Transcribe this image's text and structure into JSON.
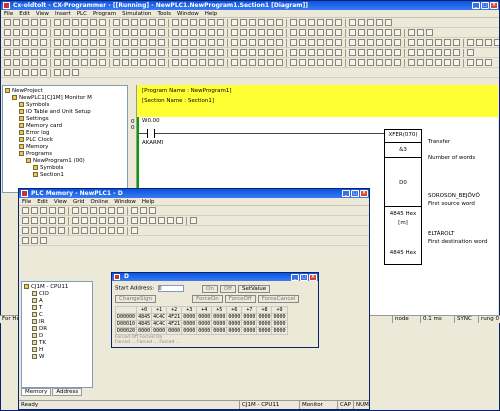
{
  "main": {
    "title": "Cx-oldtolt - CX-Programmer - [[Running] - NewPLC1.NewProgram1.Section1 [Diagram]]",
    "menu": [
      "File",
      "Edit",
      "View",
      "Insert",
      "PLC",
      "Program",
      "Simulation",
      "Tools",
      "Window",
      "Help"
    ]
  },
  "project": {
    "items": [
      {
        "label": "NewProject",
        "indent": 0
      },
      {
        "label": "NewPLC1[CJ1M] Monitor M",
        "indent": 1
      },
      {
        "label": "Symbols",
        "indent": 2
      },
      {
        "label": "IO Table and Unit Setup",
        "indent": 2
      },
      {
        "label": "Settings",
        "indent": 2
      },
      {
        "label": "Memory card",
        "indent": 2
      },
      {
        "label": "Error log",
        "indent": 2
      },
      {
        "label": "PLC Clock",
        "indent": 2
      },
      {
        "label": "Memory",
        "indent": 2
      },
      {
        "label": "Programs",
        "indent": 2
      },
      {
        "label": "NewProgram1 (00)",
        "indent": 3
      },
      {
        "label": "Symbols",
        "indent": 4
      },
      {
        "label": "Section1",
        "indent": 4
      }
    ]
  },
  "ladder": {
    "program": "[Program Name : NewProgram1]",
    "section": "[Section Name : Section1]",
    "rung_no": "0",
    "rung_step": "0",
    "contact_addr": "W0.00",
    "contact_name": "AKARMI",
    "instr": "XFER(070)",
    "op1": "&3",
    "op2": "D0",
    "op3_addr": "4845 Hex",
    "op3": "[m]",
    "op4_addr": "4845 Hex",
    "c1": "Transfer",
    "c2": "Number of words",
    "c3": "SOROSON_BEJÖVŐ",
    "c4": "First source word",
    "c5": "ELTÁROLT",
    "c6": "First destination word"
  },
  "status": {
    "left": "For Help",
    "mid1": "D0",
    "zoom": "0.1 ms",
    "sync": "SYNC",
    "rung": "rung 0",
    "node": "node"
  },
  "mem": {
    "title": "PLC Memory - NewPLC1 - D",
    "menu": [
      "File",
      "Edit",
      "View",
      "Grid",
      "Online",
      "Window",
      "Help"
    ],
    "tree_root": "CJ1M - CPU11",
    "tree": [
      "CIO",
      "A",
      "T",
      "C",
      "IR",
      "DR",
      "D",
      "TK",
      "H",
      "W"
    ],
    "tabs": [
      "Memory",
      "Address"
    ],
    "status": {
      "ready": "Ready",
      "plc": "CJ1M - CPU11",
      "mode": "Monitor",
      "cap": "CAP",
      "num": "NUM"
    }
  },
  "d": {
    "title": "D",
    "start_label": "Start Address:",
    "start_value": "0",
    "buttons": [
      "On",
      "Off",
      "SetValue",
      "ChangeSign",
      "ForceOn",
      "ForceOff",
      "ForceCancel"
    ],
    "cols": [
      "+0",
      "+1",
      "+2",
      "+3",
      "+4",
      "+5",
      "+6",
      "+7",
      "+8",
      "+9"
    ],
    "rows": [
      {
        "addr": "D00000",
        "cells": [
          "4845",
          "4C4C",
          "4F21",
          "0000",
          "0000",
          "0000",
          "0000",
          "0000",
          "0000",
          "0000"
        ]
      },
      {
        "addr": "D00010",
        "cells": [
          "4845",
          "4C4C",
          "4F21",
          "0000",
          "0000",
          "0000",
          "0000",
          "0000",
          "0000",
          "0000"
        ]
      },
      {
        "addr": "D00020",
        "cells": [
          "0000",
          "0000",
          "0000",
          "0000",
          "0000",
          "0000",
          "0000",
          "0000",
          "0000",
          "0000"
        ]
      }
    ],
    "legend1": "Forced Off    Forced On",
    "legend2": "Forced ... Forced ... Forced ..."
  }
}
